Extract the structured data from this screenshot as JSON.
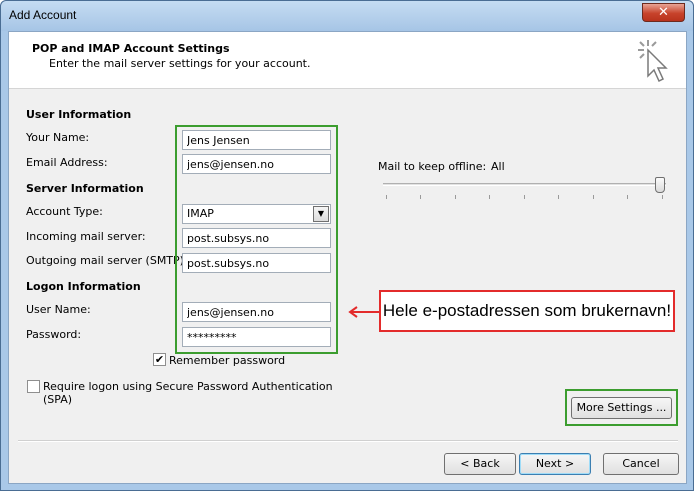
{
  "window": {
    "title": "Add Account",
    "close_glyph": "✕"
  },
  "header": {
    "title": "POP and IMAP Account Settings",
    "subtitle": "Enter the mail server settings for your account.",
    "icon": "wizard-cursor-icon"
  },
  "user_info": {
    "heading": "User Information",
    "name_label": "Your Name:",
    "name_value": "Jens Jensen",
    "email_label": "Email Address:",
    "email_value": "jens@jensen.no"
  },
  "server_info": {
    "heading": "Server Information",
    "account_type_label": "Account Type:",
    "account_type_value": "IMAP",
    "incoming_label": "Incoming mail server:",
    "incoming_value": "post.subsys.no",
    "outgoing_label": "Outgoing mail server (SMTP):",
    "outgoing_value": "post.subsys.no"
  },
  "logon_info": {
    "heading": "Logon Information",
    "username_label": "User Name:",
    "username_value": "jens@jensen.no",
    "password_label": "Password:",
    "password_value": "*********",
    "remember_label": "Remember password",
    "remember_checked": true,
    "spa_label_line1": "Require logon using Secure Password Authentication",
    "spa_label_line2": "(SPA)",
    "spa_checked": false
  },
  "offline": {
    "label": "Mail to keep offline:",
    "value": "All",
    "slider_level": 1.0
  },
  "annotation": {
    "text": "Hele e-postadressen som brukernavn!",
    "color": "#e32b2b"
  },
  "highlight_color": "#3c9d2f",
  "buttons": {
    "more_settings": "More Settings ...",
    "back": "< Back",
    "next": "Next >",
    "cancel": "Cancel"
  },
  "check_glyph": "✔"
}
